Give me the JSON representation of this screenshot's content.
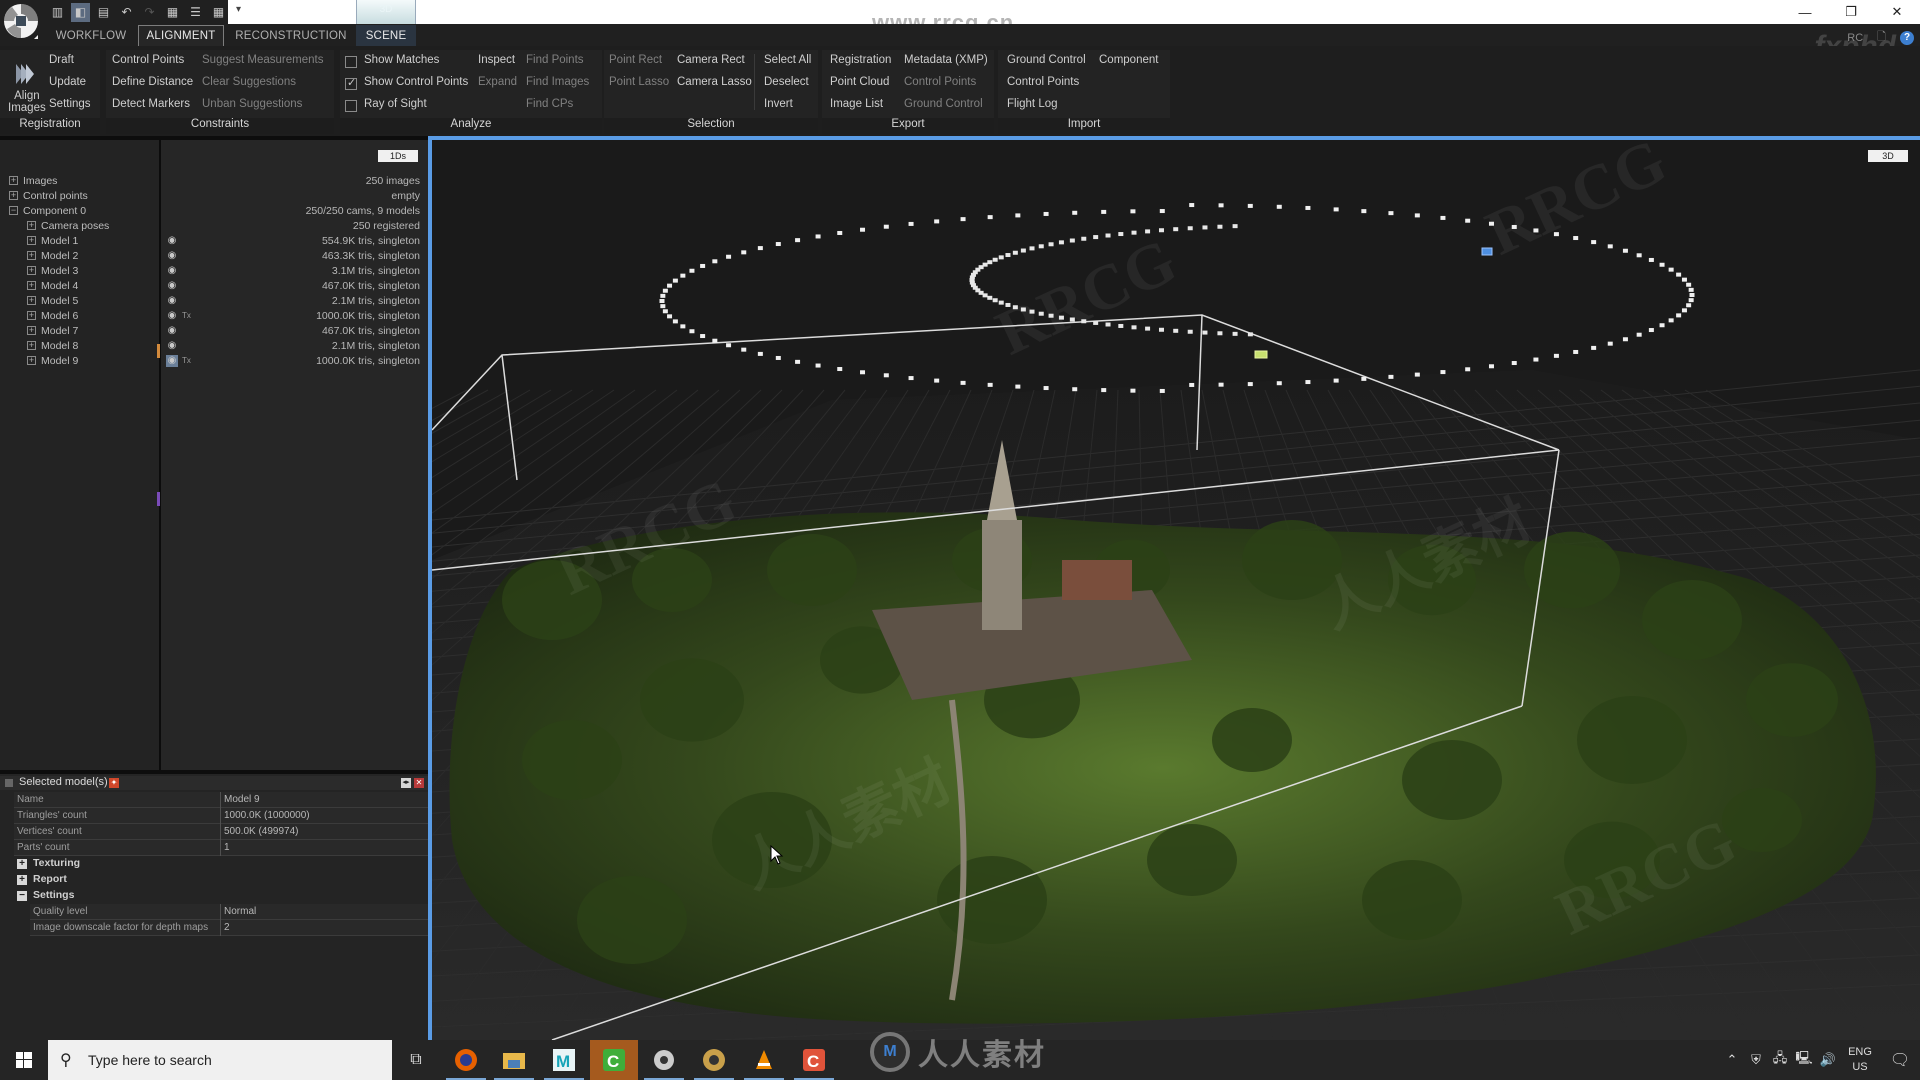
{
  "app": {
    "name": "RealityCapture",
    "quick_access": [
      "layout-1x3",
      "layout-2x1",
      "layout-1x2-top",
      "undo",
      "redo",
      "layout-grid-a",
      "layout-grid-b",
      "layout-grid-c"
    ],
    "qat_menu_glyph": "▾",
    "scene_tab_top_label": "3D",
    "watermark_url": "www.rrcg.cn",
    "window_controls": {
      "minimize": "—",
      "restore": "❐",
      "close": "✕"
    }
  },
  "tabs": [
    {
      "label": "WORKFLOW",
      "active": false
    },
    {
      "label": "ALIGNMENT",
      "active": true
    },
    {
      "label": "RECONSTRUCTION",
      "active": false
    },
    {
      "label": "SCENE",
      "active": false
    }
  ],
  "tabrow_right": {
    "rc_label": "RC",
    "help": "?",
    "fxphd": "fxphd"
  },
  "ribbon": {
    "registration": {
      "label": "Registration",
      "align_images": [
        "Align",
        "Images"
      ],
      "items": [
        "Draft",
        "Update",
        "Settings"
      ]
    },
    "constraints": {
      "label": "Constraints",
      "col1": [
        "Control Points",
        "Define Distance",
        "Detect Markers"
      ],
      "col2": [
        "Suggest Measurements",
        "Clear Suggestions",
        "Unban Suggestions"
      ]
    },
    "analyze": {
      "label": "Analyze",
      "checkboxes": [
        {
          "label": "Show Matches",
          "checked": false
        },
        {
          "label": "Show Control Points",
          "checked": true
        },
        {
          "label": "Ray of Sight",
          "checked": false
        }
      ],
      "col2": [
        "Inspect",
        "Expand"
      ],
      "col3": [
        "Find Points",
        "Find Images",
        "Find CPs"
      ]
    },
    "selection": {
      "label": "Selection",
      "col1": [
        "Point Rect",
        "Point Lasso"
      ],
      "col2": [
        "Camera Rect",
        "Camera Lasso"
      ],
      "col3": [
        "Select All",
        "Deselect",
        "Invert"
      ]
    },
    "export": {
      "label": "Export",
      "col1": [
        "Registration",
        "Point Cloud",
        "Image List"
      ],
      "col2": [
        "Metadata (XMP)",
        "Control Points",
        "Ground Control"
      ]
    },
    "import": {
      "label": "Import",
      "col1": [
        "Ground Control",
        "Control Points",
        "Flight Log"
      ],
      "col2": [
        "Component"
      ]
    }
  },
  "tree": {
    "view_mode": "1Ds",
    "rows": [
      {
        "name": "Images",
        "value": "250 images",
        "level": 0,
        "expander": "+"
      },
      {
        "name": "Control points",
        "value": "empty",
        "level": 0,
        "expander": "+"
      },
      {
        "name": "Component 0",
        "value": "250/250 cams, 9 models",
        "level": 0,
        "expander": "−"
      },
      {
        "name": "Camera poses",
        "value": "250 registered",
        "level": 1,
        "expander": "+"
      },
      {
        "name": "Model 1",
        "value": "554.9K tris, singleton",
        "level": 1,
        "expander": "+",
        "visible": true,
        "textured": false
      },
      {
        "name": "Model 2",
        "value": "463.3K tris, singleton",
        "level": 1,
        "expander": "+",
        "visible": true,
        "textured": false
      },
      {
        "name": "Model 3",
        "value": "3.1M tris, singleton",
        "level": 1,
        "expander": "+",
        "visible": true,
        "textured": false
      },
      {
        "name": "Model 4",
        "value": "467.0K tris, singleton",
        "level": 1,
        "expander": "+",
        "visible": true,
        "textured": false
      },
      {
        "name": "Model 5",
        "value": "2.1M tris, singleton",
        "level": 1,
        "expander": "+",
        "visible": true,
        "textured": false
      },
      {
        "name": "Model 6",
        "value": "1000.0K tris, singleton",
        "level": 1,
        "expander": "+",
        "visible": true,
        "textured": true
      },
      {
        "name": "Model 7",
        "value": "467.0K tris, singleton",
        "level": 1,
        "expander": "+",
        "visible": true,
        "textured": false
      },
      {
        "name": "Model 8",
        "value": "2.1M tris, singleton",
        "level": 1,
        "expander": "+",
        "visible": true,
        "textured": false
      },
      {
        "name": "Model 9",
        "value": "1000.0K tris, singleton",
        "level": 1,
        "expander": "+",
        "visible": true,
        "textured": true,
        "selected": true
      }
    ],
    "eye_glyph": "👁",
    "tx_label": "Tx"
  },
  "properties": {
    "title": "Selected model(s)",
    "rows": [
      {
        "key": "Name",
        "value": "Model 9"
      },
      {
        "key": "Triangles' count",
        "value": "1000.0K (1000000)"
      },
      {
        "key": "Vertices' count",
        "value": "500.0K (499974)"
      },
      {
        "key": "Parts' count",
        "value": "1"
      }
    ],
    "sections": [
      {
        "label": "Texturing",
        "expanded": false
      },
      {
        "label": "Report",
        "expanded": false
      },
      {
        "label": "Settings",
        "expanded": true
      }
    ],
    "settings_rows": [
      {
        "key": "Quality level",
        "value": "Normal"
      },
      {
        "key": "Image downscale factor for depth maps",
        "value": "2"
      }
    ]
  },
  "viewport": {
    "view_mode": "3D",
    "watermarks": [
      "RRCG",
      "人人素材"
    ]
  },
  "taskbar": {
    "search_placeholder": "Type here to search",
    "apps": [
      "task-view",
      "firefox",
      "file-explorer",
      "maya",
      "camtasia",
      "realitycapture",
      "blender-like",
      "vlc",
      "camtasia-recorder"
    ],
    "tray": {
      "lang_top": "ENG",
      "lang_bottom": "US"
    },
    "bottom_watermark": "人人素材"
  },
  "colors": {
    "accent_blue": "#5a9ce6",
    "ribbon_bg": "#232323",
    "panel_bg": "#262626",
    "orange_marker": "#d38a3c",
    "purple_marker": "#7a4bb8"
  }
}
